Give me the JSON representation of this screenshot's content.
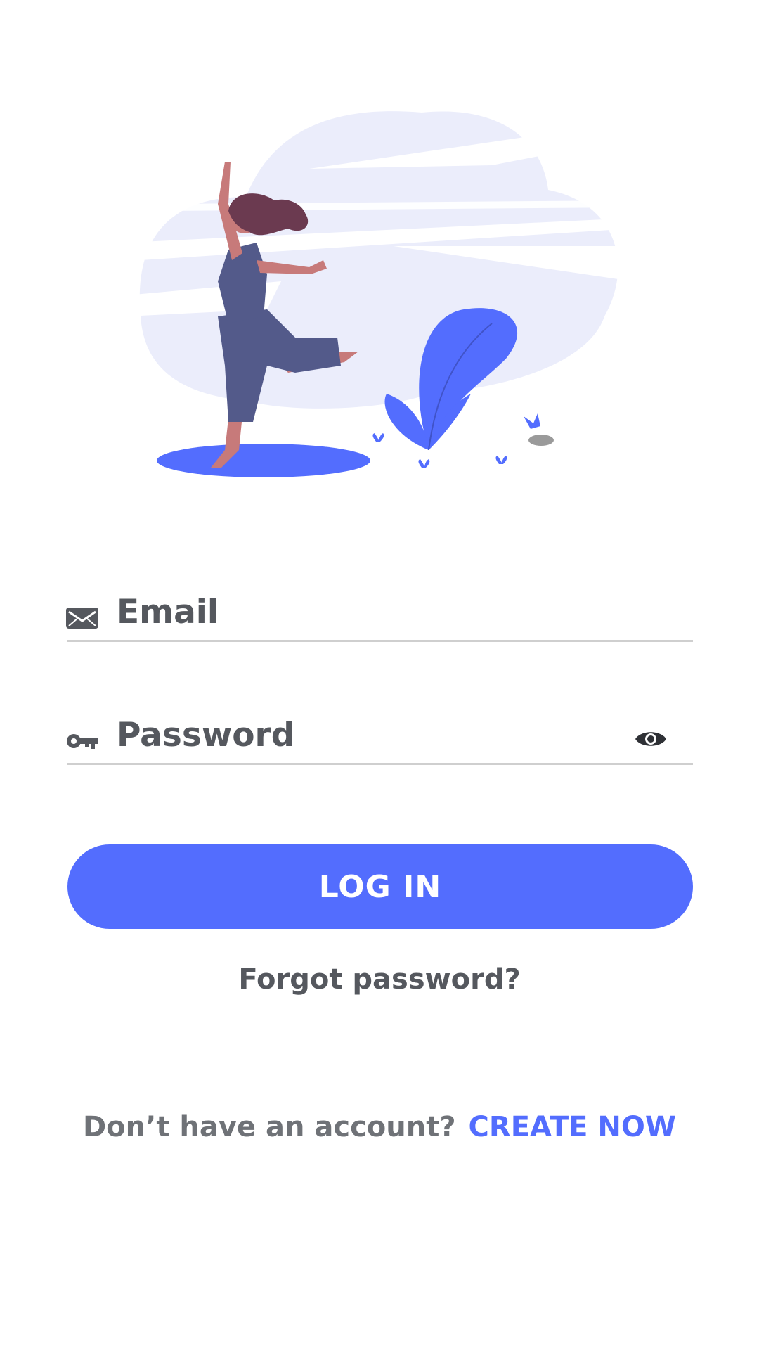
{
  "app": {
    "accent_color": "#536dfe",
    "text_color": "#55585e"
  },
  "illustration": {
    "icon": "woman-dancing-illustration"
  },
  "email_field": {
    "placeholder": "Email",
    "value": "",
    "icon": "mail-icon"
  },
  "password_field": {
    "placeholder": "Password",
    "value": "",
    "icon": "key-icon",
    "toggle_icon": "eye-icon"
  },
  "login_button": {
    "label": "LOG IN"
  },
  "forgot_link": {
    "label": "Forgot password?"
  },
  "signup": {
    "question": "Don’t have an account?",
    "link": "CREATE NOW"
  }
}
